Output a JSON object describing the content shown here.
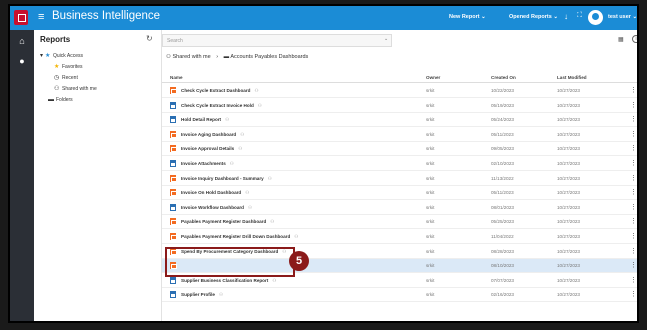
{
  "app": {
    "title": "Business Intelligence"
  },
  "topbar": {
    "new_report": "New Report",
    "opened_reports": "Opened Reports",
    "user": "test user"
  },
  "nav": {
    "title": "Reports",
    "items": [
      {
        "label": "Quick Access",
        "icon": "star-icon"
      },
      {
        "label": "Favorites",
        "icon": "star-icon"
      },
      {
        "label": "Recent",
        "icon": "clock-icon"
      },
      {
        "label": "Shared with me",
        "icon": "people-icon"
      },
      {
        "label": "Folders",
        "icon": "folder-icon"
      }
    ]
  },
  "main": {
    "search_placeholder": "Search",
    "breadcrumb": [
      "Shared with me",
      "Accounts Payables Dashboards"
    ],
    "columns": {
      "name": "Name",
      "owner": "Owner",
      "created": "Created On",
      "modified": "Last Modified"
    },
    "rows": [
      {
        "name": "Check Cycle Extract Dashboard",
        "type": "dashboard",
        "owner": "srkit",
        "created": "10/22/2023",
        "modified": "10/27/2023"
      },
      {
        "name": "Check Cycle Extract Invoice Hold",
        "type": "report",
        "owner": "srkit",
        "created": "05/19/2023",
        "modified": "10/27/2023"
      },
      {
        "name": "Hold Detail Report",
        "type": "report",
        "owner": "srkit",
        "created": "05/24/2023",
        "modified": "10/27/2023"
      },
      {
        "name": "Invoice Aging Dashboard",
        "type": "dashboard",
        "owner": "srkit",
        "created": "05/11/2023",
        "modified": "10/27/2023"
      },
      {
        "name": "Invoice Approval Details",
        "type": "dashboard",
        "owner": "srkit",
        "created": "09/05/2023",
        "modified": "10/27/2023"
      },
      {
        "name": "Invoice Attachments",
        "type": "report",
        "owner": "srkit",
        "created": "02/10/2023",
        "modified": "10/27/2023"
      },
      {
        "name": "Invoice Inquiry Dashboard - Summary",
        "type": "dashboard",
        "owner": "srkit",
        "created": "11/13/2022",
        "modified": "10/27/2023"
      },
      {
        "name": "Invoice On Hold Dashboard",
        "type": "dashboard",
        "owner": "srkit",
        "created": "05/11/2023",
        "modified": "10/27/2023"
      },
      {
        "name": "Invoice Workflow Dashboard",
        "type": "report",
        "owner": "srkit",
        "created": "08/01/2023",
        "modified": "10/27/2023"
      },
      {
        "name": "Payables Payment Register Dashboard",
        "type": "dashboard",
        "owner": "srkit",
        "created": "05/25/2023",
        "modified": "10/27/2023"
      },
      {
        "name": "Payables Payment Register Drill Down Dashboard",
        "type": "dashboard",
        "owner": "srkit",
        "created": "11/04/2022",
        "modified": "10/27/2023"
      },
      {
        "name": "Spend By Procurement Category Dashboard",
        "type": "dashboard",
        "owner": "srkit",
        "created": "08/28/2023",
        "modified": "10/27/2023"
      },
      {
        "name": "",
        "type": "dashboard",
        "owner": "srkit",
        "created": "08/10/2023",
        "modified": "10/27/2023",
        "selected": true
      },
      {
        "name": "Supplier Business Classification Report",
        "type": "report",
        "owner": "srkit",
        "created": "07/07/2023",
        "modified": "10/27/2023"
      },
      {
        "name": "Supplier Profile",
        "type": "report",
        "owner": "srkit",
        "created": "02/16/2023",
        "modified": "10/27/2023"
      }
    ]
  },
  "annotation": {
    "step": "5"
  }
}
